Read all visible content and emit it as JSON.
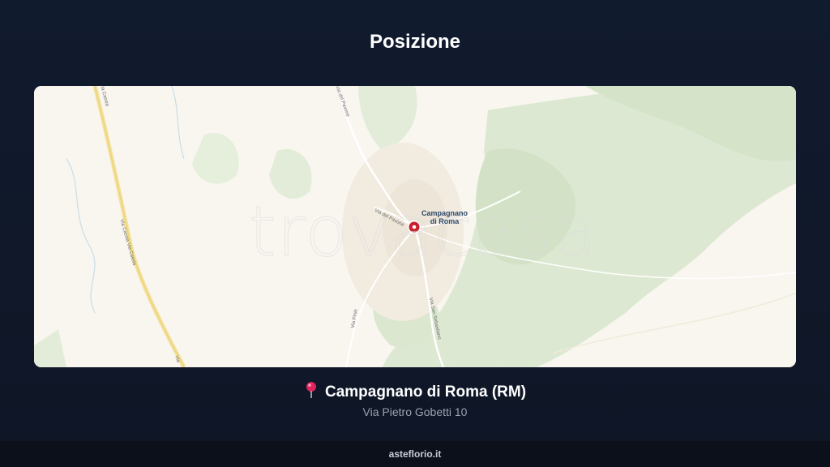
{
  "header": {
    "title": "Posizione"
  },
  "map": {
    "watermark": "trovacasa",
    "place_label_line1": "Campagnano",
    "place_label_line2": "di Roma",
    "roads": {
      "via_cassia_top": "Via Cassia",
      "via_cassia_mid": "Via Cassia Via Cassia",
      "via_del_pavone_top": "Via del Pavone",
      "via_del_pavone": "Via del Pavone",
      "via_san_sebastiano": "Via San Sebastiano",
      "via_pinie": "Via Pinie",
      "via_bottom": "Via"
    },
    "marker_color": "#c8202e"
  },
  "location": {
    "pin_icon": "pushpin-icon",
    "name": "Campagnano di Roma (RM)",
    "address": "Via Pietro Gobetti 10"
  },
  "footer": {
    "site": "asteflorio.it"
  }
}
